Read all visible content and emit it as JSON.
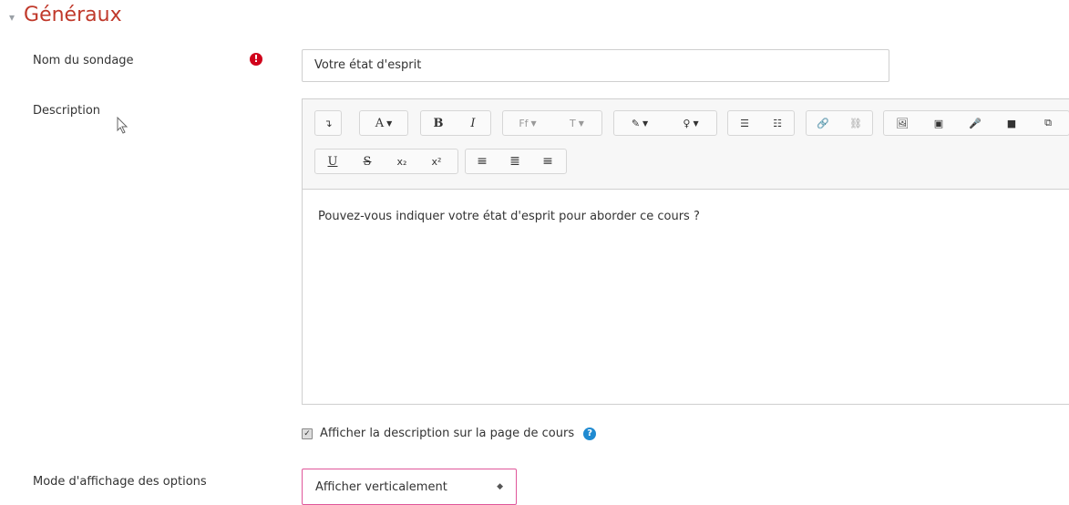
{
  "section": {
    "title": "Généraux"
  },
  "form": {
    "name_label": "Nom du sondage",
    "name_value": "Votre état d'esprit",
    "description_label": "Description",
    "editor_content": "Pouvez-vous indiquer votre état d'esprit pour aborder ce cours ?",
    "show_description_label": "Afficher la description sur la page de cours",
    "display_mode_label": "Mode d'affichage des options",
    "display_mode_value": "Afficher verticalement"
  },
  "toolbar": {
    "row1": {
      "collapse": "↴",
      "font": "A",
      "bold": "B",
      "italic": "I",
      "font_family": "Ff",
      "font_size": "T",
      "color": "✎",
      "highlight": "♀",
      "bullet_list": "☰",
      "numbered_list": "☷",
      "link": "🔗",
      "unlink": "⛓",
      "image": "🖼",
      "media": "▣",
      "record_audio": "🎤",
      "record_video": "■",
      "copy": "⧉"
    },
    "row2": {
      "underline": "U",
      "strikethrough": "S",
      "subscript": "x₂",
      "superscript": "x²",
      "align_left": "≡",
      "align_center": "≣",
      "align_right": "≡"
    }
  },
  "colors": {
    "section_title": "#c0392b",
    "required": "#d0021b",
    "select_border": "#e0569a",
    "help": "#1f8ad1"
  }
}
